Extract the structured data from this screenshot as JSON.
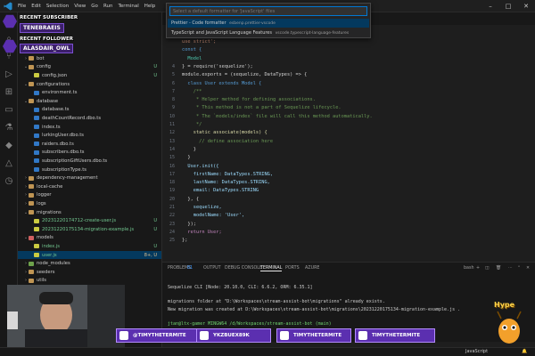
{
  "titlebar": {
    "menu": [
      "File",
      "Edit",
      "Selection",
      "View",
      "Go",
      "Run",
      "Terminal",
      "Help"
    ],
    "controls": {
      "minimize": "–",
      "maximize": "□",
      "close": "✕"
    }
  },
  "overlay": {
    "recent_subscriber_label": "RECENT SUBSCRIBER",
    "recent_subscriber_name": "TENEBRAEIS",
    "recent_follower_label": "RECENT FOLLOWER",
    "recent_follower_name": "ALASDAIR_OWL",
    "socials": [
      "@TIMYTHETERMITE",
      "YKZBUEX89K",
      "TIMYTHETERMITE",
      "TIMYTHETERMITE"
    ],
    "mascot_text": "Hype"
  },
  "explorer": {
    "rows": [
      {
        "label": "bot",
        "type": "folder",
        "indent": 1,
        "chev": "›",
        "badge": ""
      },
      {
        "label": "config",
        "type": "folder",
        "indent": 1,
        "chev": "⌄",
        "badge": "U"
      },
      {
        "label": "config.json",
        "type": "json",
        "indent": 2,
        "chev": "",
        "badge": "U"
      },
      {
        "label": "configurations",
        "type": "folder",
        "indent": 1,
        "chev": "⌄",
        "badge": ""
      },
      {
        "label": "environment.ts",
        "type": "ts",
        "indent": 2,
        "chev": "",
        "badge": ""
      },
      {
        "label": "database",
        "type": "folder",
        "indent": 1,
        "chev": "⌄",
        "badge": ""
      },
      {
        "label": "database.ts",
        "type": "ts",
        "indent": 2,
        "chev": "",
        "badge": ""
      },
      {
        "label": "deathCountRecord.dbo.ts",
        "type": "ts",
        "indent": 2,
        "chev": "",
        "badge": ""
      },
      {
        "label": "index.ts",
        "type": "ts",
        "indent": 2,
        "chev": "",
        "badge": ""
      },
      {
        "label": "lurkingUser.dbo.ts",
        "type": "ts",
        "indent": 2,
        "chev": "",
        "badge": ""
      },
      {
        "label": "raiders.dbo.ts",
        "type": "ts",
        "indent": 2,
        "chev": "",
        "badge": ""
      },
      {
        "label": "subscribers.dbo.ts",
        "type": "ts",
        "indent": 2,
        "chev": "",
        "badge": ""
      },
      {
        "label": "subscriptionGiftUsers.dbo.ts",
        "type": "ts",
        "indent": 2,
        "chev": "",
        "badge": ""
      },
      {
        "label": "subscriptionType.ts",
        "type": "ts",
        "indent": 2,
        "chev": "",
        "badge": ""
      },
      {
        "label": "dependency-management",
        "type": "folder",
        "indent": 1,
        "chev": "›",
        "badge": ""
      },
      {
        "label": "local-cache",
        "type": "folder",
        "indent": 1,
        "chev": "›",
        "badge": ""
      },
      {
        "label": "logger",
        "type": "folder",
        "indent": 1,
        "chev": "›",
        "badge": ""
      },
      {
        "label": "logs",
        "type": "folder",
        "indent": 1,
        "chev": "›",
        "badge": ""
      },
      {
        "label": "migrations",
        "type": "folder",
        "indent": 1,
        "chev": "⌄",
        "badge": ""
      },
      {
        "label": "20231220174712-create-user.js",
        "type": "js",
        "indent": 2,
        "chev": "",
        "badge": "U"
      },
      {
        "label": "20231220175134-migration-example.js",
        "type": "js",
        "indent": 2,
        "chev": "",
        "badge": "U"
      },
      {
        "label": "models",
        "type": "folder-red",
        "indent": 1,
        "chev": "⌄",
        "badge": ""
      },
      {
        "label": "index.js",
        "type": "js",
        "indent": 2,
        "chev": "",
        "badge": "U"
      },
      {
        "label": "user.js",
        "type": "js",
        "indent": 2,
        "chev": "",
        "badge": "8+, U",
        "selected": true
      },
      {
        "label": "node_modules",
        "type": "folder-green",
        "indent": 1,
        "chev": "›",
        "badge": ""
      },
      {
        "label": "seeders",
        "type": "folder",
        "indent": 1,
        "chev": "›",
        "badge": ""
      },
      {
        "label": "utils",
        "type": "folder",
        "indent": 1,
        "chev": "›",
        "badge": ""
      }
    ]
  },
  "command_palette": {
    "placeholder": "Select a default formatter for 'JavaScript' files",
    "options": [
      {
        "name": "Prettier - Code formatter",
        "id": "esbenp.prettier-vscode",
        "active": true
      },
      {
        "name": "TypeScript and JavaScript Language Features",
        "id": "vscode.typescript-language-features",
        "active": false
      }
    ]
  },
  "editor": {
    "line_numbers": [
      "4",
      "5",
      "6",
      "7",
      "8",
      "9",
      "10",
      "11",
      "12",
      "13",
      "14",
      "15",
      "16",
      "17",
      "18",
      "19",
      "20",
      "21",
      "22",
      "23",
      "24",
      "25"
    ],
    "code": {
      "l2": "use strict';",
      "l3": "const {",
      "l4": "  Model",
      "l5": "} = require('sequelize');",
      "l6": "module.exports = (sequelize, DataTypes) => {",
      "l7": "  class User extends Model {",
      "l8": "    /**",
      "l9": "     * Helper method for defining associations.",
      "l10": "     * This method is not a part of Sequelize lifecycle.",
      "l11": "     * The `models/index` file will call this method automatically.",
      "l12": "     */",
      "l13": "    static associate(models) {",
      "l14": "      // define association here",
      "l15": "    }",
      "l16": "  }",
      "l17": "  User.init({",
      "l18": "    firstName: DataTypes.STRING,",
      "l19": "    lastName: DataTypes.STRING,",
      "l20": "    email: DataTypes.STRING",
      "l21": "  }, {",
      "l22": "    sequelize,",
      "l23": "    modelName: 'User',",
      "l24": "  });",
      "l25": "  return User;",
      "l26": "};"
    }
  },
  "panel": {
    "tabs": [
      "PROBLEMS",
      "OUTPUT",
      "DEBUG CONSOLE",
      "TERMINAL",
      "PORTS",
      "AZURE"
    ],
    "problems_count": "81",
    "terminal_name": "bash",
    "terminal_lines": [
      "Sequelize CLI [Node: 20.10.0, CLI: 6.6.2, ORM: 6.35.1]",
      "",
      "migrations folder at \"D:\\Workspaces\\stream-assist-bot\\migrations\" already exists.",
      "New migration was created at D:\\Workspaces\\stream-assist-bot\\migrations\\20231220175134-migration-example.js .",
      "",
      "jtan@ltx-gamer MINGW64 /d/Workspaces/stream-assist-bot (main)",
      "$ "
    ]
  },
  "statusbar": {
    "language": "JavaScript",
    "bell": "🔔"
  },
  "colors": {
    "accent": "#0078d4",
    "overlay_purple": "#5b2fb0",
    "selection": "#04395e"
  }
}
